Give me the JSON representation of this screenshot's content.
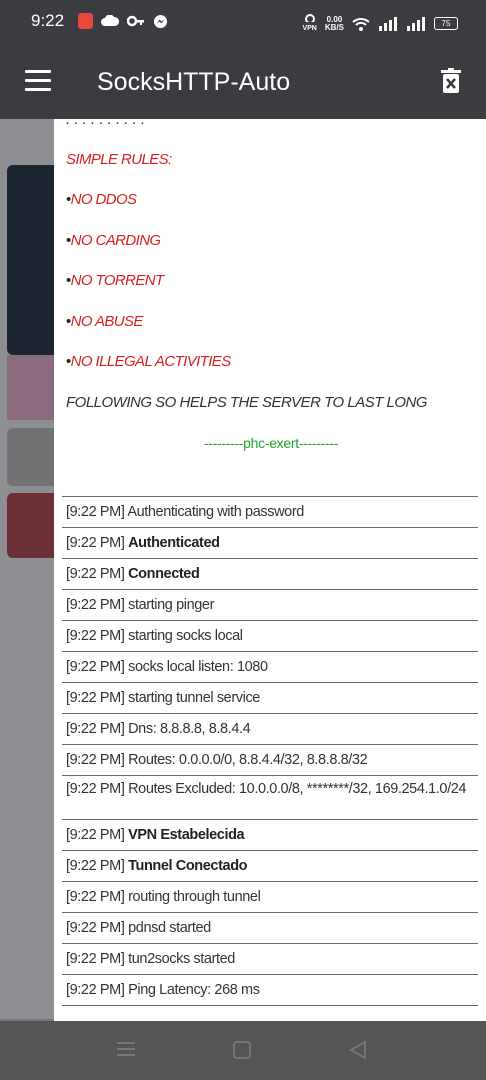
{
  "status_bar": {
    "time": "9:22",
    "net_speed_value": "0.00",
    "net_speed_unit": "KB/S",
    "vpn_label": "VPN",
    "battery": "75"
  },
  "app_bar": {
    "title": "SocksHTTP-Auto"
  },
  "dialog": {
    "rules": [
      {
        "bullet": "",
        "text": "SIMPLE RULES:"
      },
      {
        "bullet": "•",
        "text": "NO DDOS"
      },
      {
        "bullet": "•",
        "text": "NO CARDING"
      },
      {
        "bullet": "•",
        "text": "NO TORRENT"
      },
      {
        "bullet": "•",
        "text": "NO ABUSE"
      },
      {
        "bullet": "•",
        "text": "NO ILLEGAL ACTIVITIES"
      }
    ],
    "following": "FOLLOWING SO HELPS THE SERVER TO LAST LONG",
    "signature": "---------phc-exert---------"
  },
  "log": [
    {
      "time": "[9:22 PM]",
      "text": "Authenticating with password",
      "bold": false
    },
    {
      "time": "[9:22 PM]",
      "text": "Authenticated",
      "bold": true
    },
    {
      "time": "[9:22 PM]",
      "text": "Connected",
      "bold": true
    },
    {
      "time": "[9:22 PM]",
      "text": "starting pinger",
      "bold": false
    },
    {
      "time": "[9:22 PM]",
      "text": "starting socks local",
      "bold": false
    },
    {
      "time": "[9:22 PM]",
      "text": "socks local listen: 1080",
      "bold": false
    },
    {
      "time": "[9:22 PM]",
      "text": "starting tunnel service",
      "bold": false
    },
    {
      "time": "[9:22 PM]",
      "text": "Dns: 8.8.8.8, 8.8.4.4",
      "bold": false
    },
    {
      "time": "[9:22 PM]",
      "text": "Routes: 0.0.0.0/0, 8.8.4.4/32, 8.8.8.8/32",
      "bold": false
    },
    {
      "time": "[9:22 PM]",
      "text": "Routes Excluded: 10.0.0.0/8, ********/32, 169.254.1.0/24",
      "bold": false
    },
    {
      "time": "[9:22 PM]",
      "text": "VPN Estabelecida",
      "bold": true
    },
    {
      "time": "[9:22 PM]",
      "text": "Tunnel Conectado",
      "bold": true
    },
    {
      "time": "[9:22 PM]",
      "text": "routing through tunnel",
      "bold": false
    },
    {
      "time": "[9:22 PM]",
      "text": "pdnsd started",
      "bold": false
    },
    {
      "time": "[9:22 PM]",
      "text": "tun2socks started",
      "bold": false
    },
    {
      "time": "[9:22 PM]",
      "text": "Ping Latency: 268 ms",
      "bold": false
    }
  ],
  "colors": {
    "rule_red": "#d81f1f",
    "signature_green": "#1aa52a",
    "appbar": "#3a3c3f"
  }
}
